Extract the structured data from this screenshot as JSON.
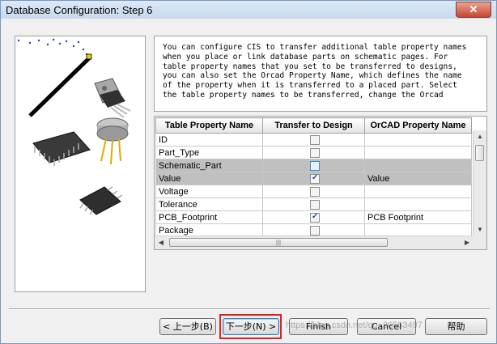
{
  "window": {
    "title": "Database Configuration: Step 6",
    "close_label": "✕"
  },
  "description": "You can configure CIS to transfer additional table property names\nwhen you place or link database parts on schematic pages. For\ntable property names that you set to be transferred to designs,\nyou can also set the Orcad Property Name, which defines the name\nof the property when it is transferred to a placed part. Select\nthe table property names to be transferred, change the Orcad",
  "table": {
    "headers": [
      "Table Property Name",
      "Transfer to Design",
      "OrCAD Property Name"
    ],
    "rows": [
      {
        "name": "ID",
        "transfer": false,
        "orcad": "",
        "selected": false
      },
      {
        "name": "Part_Type",
        "transfer": false,
        "orcad": "",
        "selected": false
      },
      {
        "name": "Schematic_Part",
        "transfer": false,
        "orcad": "",
        "selected": true
      },
      {
        "name": "Value",
        "transfer": true,
        "orcad": "Value",
        "selected": true
      },
      {
        "name": "Voltage",
        "transfer": false,
        "orcad": "",
        "selected": false
      },
      {
        "name": "Tolerance",
        "transfer": false,
        "orcad": "",
        "selected": false
      },
      {
        "name": "PCB_Footprint",
        "transfer": true,
        "orcad": "PCB Footprint",
        "selected": false
      },
      {
        "name": "Package",
        "transfer": false,
        "orcad": "",
        "selected": false
      }
    ]
  },
  "buttons": {
    "back": "< 上一步(B)",
    "next": "下一步(N) >",
    "finish": "Finish",
    "cancel": "Cancel",
    "help": "帮助"
  },
  "watermark": "https://blog.csdn.net/qq_36563497",
  "colors": {
    "highlight": "#e02020",
    "selected_row": "#c0c0c0",
    "titlebar": "#c7d9ee"
  }
}
